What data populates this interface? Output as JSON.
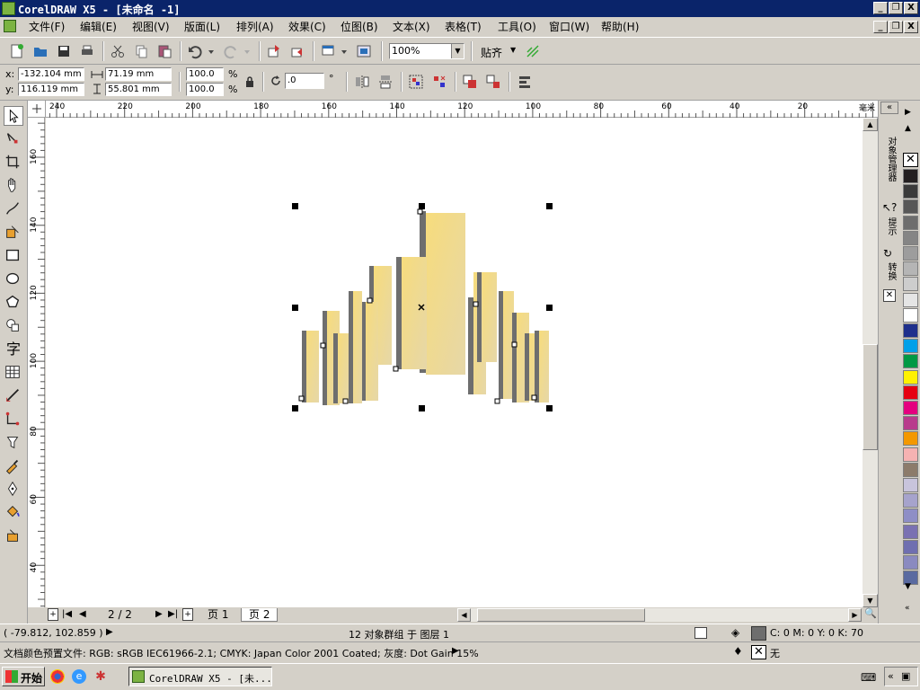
{
  "window": {
    "title": "CorelDRAW X5 - [未命名 -1]",
    "controls": [
      "_",
      "❐",
      "X"
    ]
  },
  "menu": {
    "items": [
      "文件(F)",
      "编辑(E)",
      "视图(V)",
      "版面(L)",
      "排列(A)",
      "效果(C)",
      "位图(B)",
      "文本(X)",
      "表格(T)",
      "工具(O)",
      "窗口(W)",
      "帮助(H)"
    ]
  },
  "toolbar": {
    "zoom_value": "100%",
    "snap_label": "贴齐"
  },
  "property_bar": {
    "x_label": "x:",
    "y_label": "y:",
    "x_value": "-132.104 mm",
    "y_value": "116.119 mm",
    "width_value": "71.19 mm",
    "height_value": "55.801 mm",
    "scale_x": "100.0",
    "scale_y": "100.0",
    "percent": "%",
    "rotation_value": ".0",
    "degree": "°"
  },
  "ruler": {
    "horizontal_ticks": [
      "240",
      "220",
      "200",
      "180",
      "160",
      "140",
      "120",
      "100",
      "80",
      "60",
      "40",
      "20"
    ],
    "unit": "毫米",
    "vertical_ticks": [
      "160",
      "140",
      "120",
      "100",
      "80",
      "60",
      "40"
    ]
  },
  "page_nav": {
    "counter": "2 / 2",
    "tabs": [
      "页 1",
      "页 2"
    ],
    "active_tab": "页 2"
  },
  "docker": {
    "tabs": [
      "对象管理器",
      "提示",
      "转换"
    ]
  },
  "palette": {
    "colors": [
      "#ffffff",
      "#231f20",
      "#3a3a3a",
      "#575757",
      "#6d6d6d",
      "#858585",
      "#9d9d9d",
      "#b5b5b5",
      "#cdcdcd",
      "#e5e5e5",
      "#ffffff",
      "#1e2f8c",
      "#00a0e9",
      "#009944",
      "#fff100",
      "#e60012",
      "#e4007f",
      "#b83b8c",
      "#f39800",
      "#f5b2b2",
      "#8c7b6b",
      "#c8c4dc",
      "#a6a3cc",
      "#8e8ec6",
      "#7a71b2",
      "#6f6fb0",
      "#8a8ac0",
      "#5a6aa0"
    ]
  },
  "status": {
    "coords": "( -79.812, 102.859 )",
    "selection_info": "12 对象群组 于 图层 1",
    "fill_info": "C: 0 M: 0 Y: 0 K: 70",
    "color_profile": "文档颜色预置文件: RGB: sRGB IEC61966-2.1; CMYK: Japan Color 2001 Coated; 灰度: Dot Gain 15%",
    "outline_info": "无"
  },
  "taskbar": {
    "start_label": "开始",
    "window_button": "CorelDRAW X5 - [未..."
  },
  "colors": {
    "title_bg": "#0a246a",
    "canvas_bg": "#ffffff",
    "shape_fill": "#f5d97a",
    "shadow": "#6e6e6e"
  }
}
